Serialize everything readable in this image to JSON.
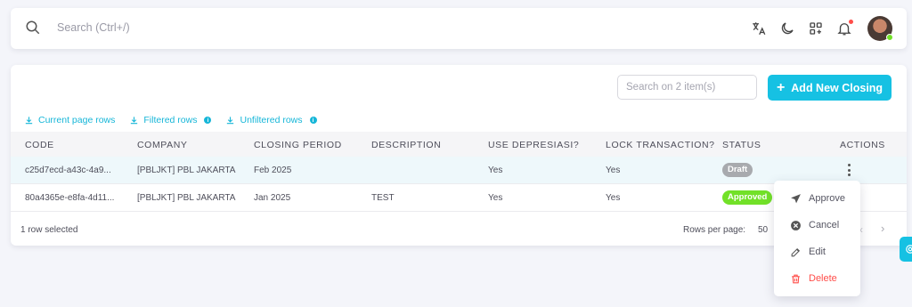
{
  "header": {
    "search_placeholder": "Search (Ctrl+/)",
    "icons": [
      "translate-icon",
      "moon-icon",
      "grid-add-icon",
      "bell-icon"
    ]
  },
  "toolbar": {
    "search_placeholder": "Search on 2 item(s)",
    "add_button": "Add New Closing"
  },
  "exports": {
    "current": "Current page rows",
    "filtered": "Filtered rows",
    "unfiltered": "Unfiltered rows"
  },
  "table": {
    "columns": [
      "CODE",
      "COMPANY",
      "CLOSING PERIOD",
      "DESCRIPTION",
      "USE DEPRESIASI?",
      "LOCK TRANSACTION?",
      "STATUS",
      "ACTIONS"
    ],
    "rows": [
      {
        "code": "c25d7ecd-a43c-4a9...",
        "company": "[PBLJKT] PBL JAKARTA",
        "period": "Feb 2025",
        "description": "",
        "use_depresiasi": "Yes",
        "lock": "Yes",
        "status": "Draft"
      },
      {
        "code": "80a4365e-e8fa-4d11...",
        "company": "[PBLJKT] PBL JAKARTA",
        "period": "Jan 2025",
        "description": "TEST",
        "use_depresiasi": "Yes",
        "lock": "Yes",
        "status": "Approved"
      }
    ]
  },
  "footer": {
    "selected": "1 row selected",
    "rows_per_page_label": "Rows per page:",
    "rows_per_page_value": "50"
  },
  "action_menu": {
    "approve": "Approve",
    "cancel": "Cancel",
    "edit": "Edit",
    "delete": "Delete"
  },
  "colors": {
    "accent": "#16c1e3",
    "draft": "#a8aaae",
    "approved": "#72e128",
    "danger": "#ff4d49"
  }
}
